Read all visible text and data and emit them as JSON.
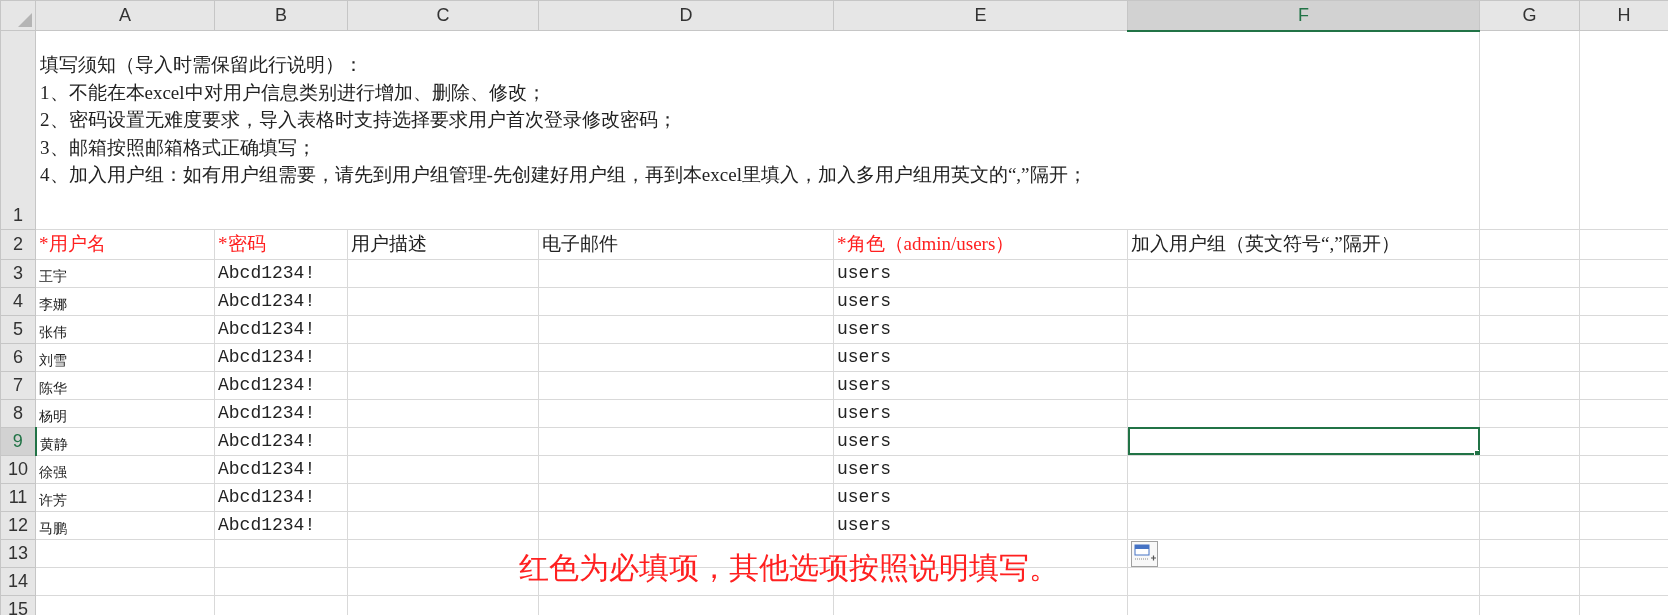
{
  "columns": [
    {
      "label": "A",
      "selected": false
    },
    {
      "label": "B",
      "selected": false
    },
    {
      "label": "C",
      "selected": false
    },
    {
      "label": "D",
      "selected": false
    },
    {
      "label": "E",
      "selected": false
    },
    {
      "label": "F",
      "selected": true
    },
    {
      "label": "G",
      "selected": false
    },
    {
      "label": "H",
      "selected": false
    }
  ],
  "rows": [
    {
      "label": "1",
      "selected": false
    },
    {
      "label": "2",
      "selected": false
    },
    {
      "label": "3",
      "selected": false
    },
    {
      "label": "4",
      "selected": false
    },
    {
      "label": "5",
      "selected": false
    },
    {
      "label": "6",
      "selected": false
    },
    {
      "label": "7",
      "selected": false
    },
    {
      "label": "8",
      "selected": false
    },
    {
      "label": "9",
      "selected": true
    },
    {
      "label": "10",
      "selected": false
    },
    {
      "label": "11",
      "selected": false
    },
    {
      "label": "12",
      "selected": false
    },
    {
      "label": "13",
      "selected": false
    },
    {
      "label": "14",
      "selected": false
    },
    {
      "label": "15",
      "selected": false
    }
  ],
  "notice": [
    "填写须知（导入时需保留此行说明）：",
    "1、不能在本excel中对用户信息类别进行增加、删除、修改；",
    "2、密码设置无难度要求，导入表格时支持选择要求用户首次登录修改密码；",
    "3、邮箱按照邮箱格式正确填写；",
    "4、加入用户组：如有用户组需要，请先到用户组管理-先创建好用户组，再到本excel里填入，加入多用户组用英文的“,”隔开；"
  ],
  "header": [
    {
      "text": "*用户名",
      "required": true
    },
    {
      "text": "*密码",
      "required": true
    },
    {
      "text": "用户描述",
      "required": false
    },
    {
      "text": "电子邮件",
      "required": false
    },
    {
      "text": "*角色（admin/users）",
      "required": true
    },
    {
      "text": "加入用户组（英文符号“,”隔开）",
      "required": false
    }
  ],
  "records": [
    {
      "name": "王宇",
      "password": "Abcd1234!",
      "role": "users"
    },
    {
      "name": "李娜",
      "password": "Abcd1234!",
      "role": "users"
    },
    {
      "name": "张伟",
      "password": "Abcd1234!",
      "role": "users"
    },
    {
      "name": "刘雪",
      "password": "Abcd1234!",
      "role": "users"
    },
    {
      "name": "陈华",
      "password": "Abcd1234!",
      "role": "users"
    },
    {
      "name": "杨明",
      "password": "Abcd1234!",
      "role": "users"
    },
    {
      "name": "黄静",
      "password": "Abcd1234!",
      "role": "users"
    },
    {
      "name": "徐强",
      "password": "Abcd1234!",
      "role": "users"
    },
    {
      "name": "许芳",
      "password": "Abcd1234!",
      "role": "users"
    },
    {
      "name": "马鹏",
      "password": "Abcd1234!",
      "role": "users"
    }
  ],
  "note": "红色为必填项，其他选项按照说明填写。"
}
